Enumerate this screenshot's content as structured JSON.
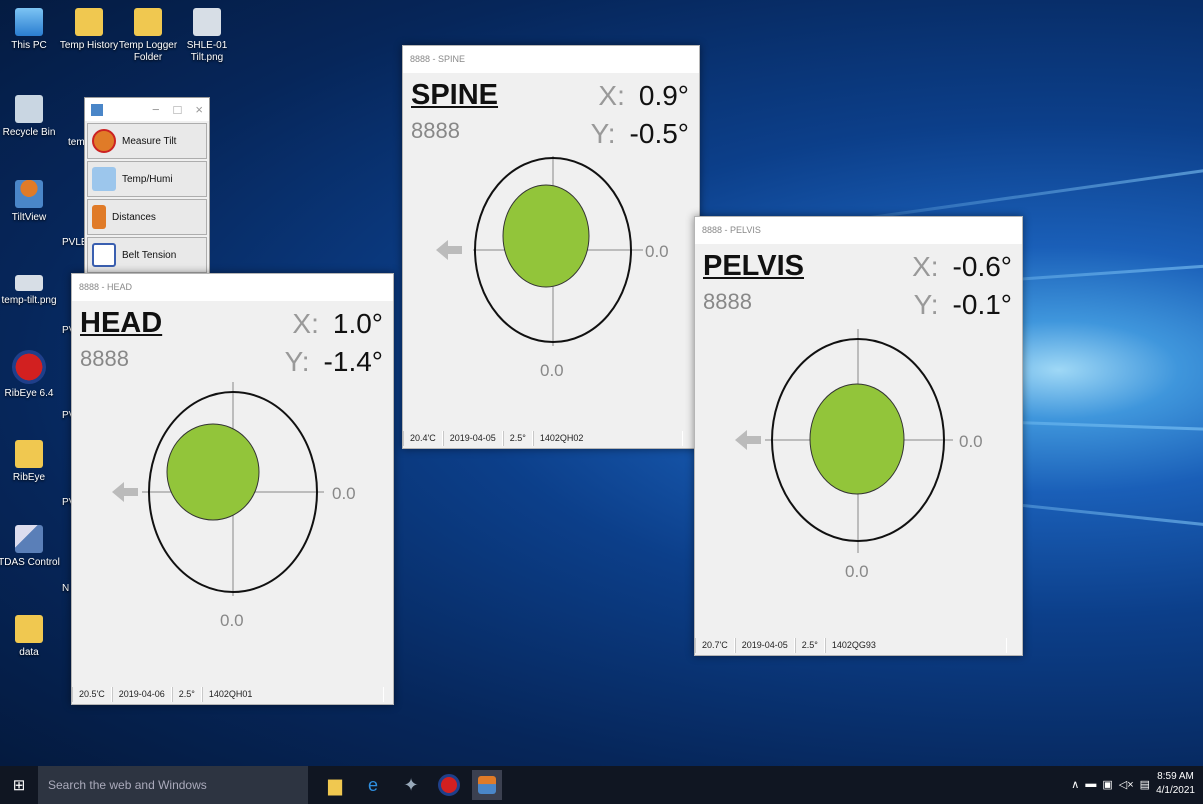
{
  "desktop": {
    "icons": [
      {
        "label": "This PC",
        "icon": "computer-icon",
        "color": "#4aa3e8"
      },
      {
        "label": "Temp History",
        "icon": "folder-icon",
        "color": "#f0c850"
      },
      {
        "label": "Temp Logger Folder",
        "icon": "folder-icon",
        "color": "#f0c850"
      },
      {
        "label": "SHLE-01 Tilt.png",
        "icon": "image-file-icon",
        "color": "#d7dee6"
      },
      {
        "label": "Recycle Bin",
        "icon": "recycle-bin-icon",
        "color": "#c9d6e2"
      },
      {
        "label": "TiltView",
        "icon": "tiltview-icon",
        "color": "#e07b28"
      },
      {
        "label": "temp-tilt.png",
        "icon": "image-file-icon",
        "color": "#d7dee6"
      },
      {
        "label": "RibEye 6.4",
        "icon": "ribeye-icon",
        "color": "#d22020"
      },
      {
        "label": "RibEye",
        "icon": "folder-icon",
        "color": "#f0c850"
      },
      {
        "label": "TDAS Control",
        "icon": "tdas-icon",
        "color": "#5a7fb8"
      },
      {
        "label": "data",
        "icon": "folder-icon",
        "color": "#f0c850"
      }
    ],
    "partial_labels": [
      "tem",
      "PVLE",
      "PV",
      "PV",
      "PV",
      "N"
    ]
  },
  "launcher": {
    "buttons": [
      {
        "label": "Measure Tilt",
        "icon": "measure-tilt-icon"
      },
      {
        "label": "Temp/Humi",
        "icon": "temp-humi-icon"
      },
      {
        "label": "Distances",
        "icon": "distances-icon"
      },
      {
        "label": "Belt Tension",
        "icon": "belt-tension-icon"
      }
    ]
  },
  "windows": {
    "head": {
      "title": "8888 - HEAD",
      "name": "HEAD",
      "id": "8888",
      "x_label": "X:",
      "x_value": "1.0°",
      "y_label": "Y:",
      "y_value": "-1.4°",
      "right_value": "0.0",
      "bottom_value": "0.0",
      "status": {
        "temp": "20.5'C",
        "date": "2019-04-06",
        "angle": "2.5°",
        "serial": "1402QH01"
      }
    },
    "spine": {
      "title": "8888 - SPINE",
      "name": "SPINE",
      "id": "8888",
      "x_label": "X:",
      "x_value": "0.9°",
      "y_label": "Y:",
      "y_value": "-0.5°",
      "right_value": "0.0",
      "bottom_value": "0.0",
      "status": {
        "temp": "20.4'C",
        "date": "2019-04-05",
        "angle": "2.5°",
        "serial": "1402QH02"
      }
    },
    "pelvis": {
      "title": "8888 - PELVIS",
      "name": "PELVIS",
      "id": "8888",
      "x_label": "X:",
      "x_value": "-0.6°",
      "y_label": "Y:",
      "y_value": "-0.1°",
      "right_value": "0.0",
      "bottom_value": "0.0",
      "status": {
        "temp": "20.7'C",
        "date": "2019-04-05",
        "angle": "2.5°",
        "serial": "1402QG93"
      }
    }
  },
  "colors": {
    "bubble": "#92c53a",
    "ring": "#111111",
    "crosshair": "#888888"
  },
  "taskbar": {
    "search_placeholder": "Search the web and Windows",
    "apps": [
      "file-explorer-icon",
      "edge-icon",
      "app-icon",
      "ribeye-icon",
      "tiltview-icon"
    ],
    "time": "8:59 AM",
    "date": "4/1/2021"
  }
}
